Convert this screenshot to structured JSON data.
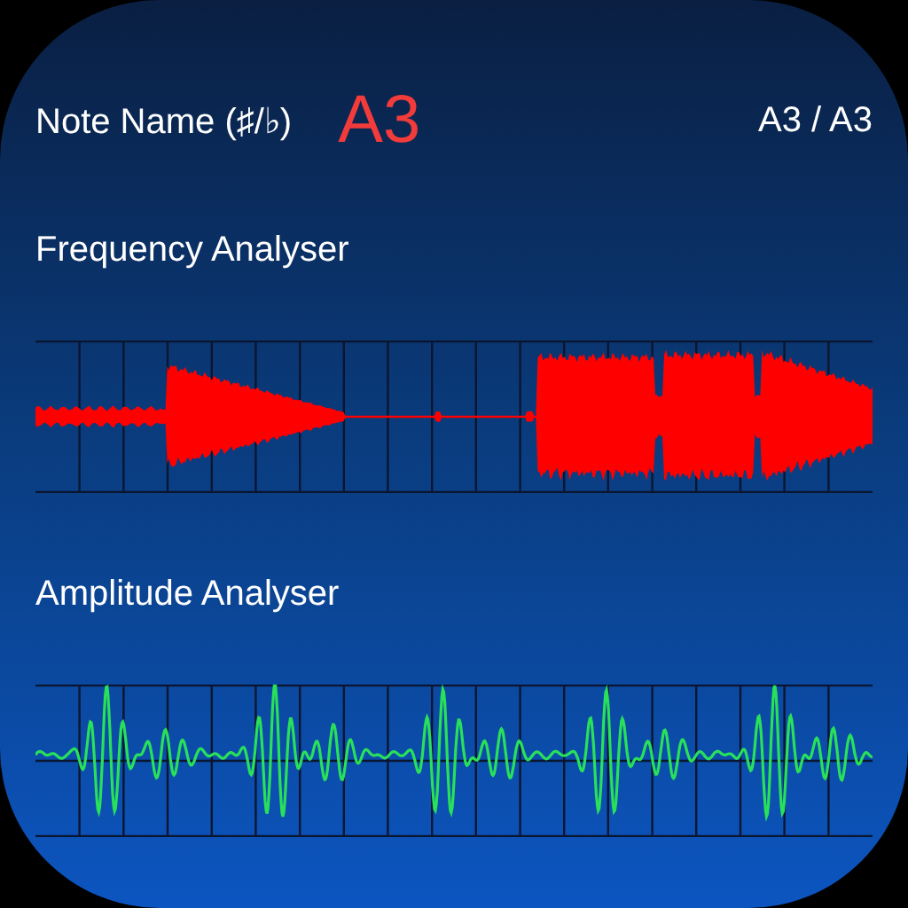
{
  "header": {
    "label": "Note Name (♯/♭)",
    "note": "A3",
    "reading": "A3 / A3"
  },
  "sections": [
    {
      "title": "Frequency Analyser",
      "kind": "envelope"
    },
    {
      "title": "Amplitude Analyser",
      "kind": "oscillation"
    }
  ]
}
